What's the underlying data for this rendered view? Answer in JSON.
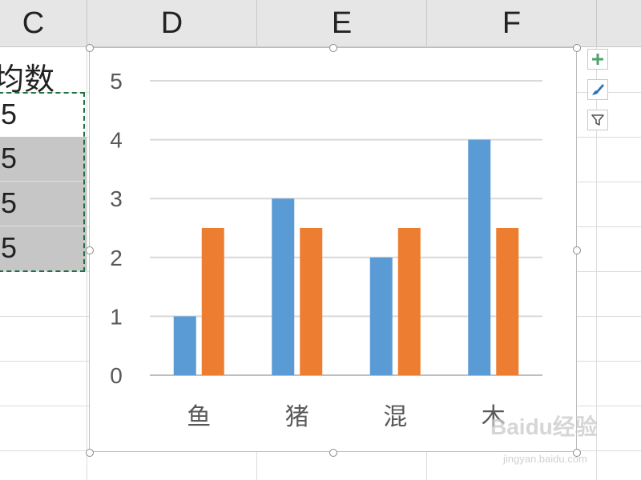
{
  "spreadsheet": {
    "columns": [
      "C",
      "D",
      "E",
      "F"
    ],
    "c_column": {
      "header_text": "均数",
      "values": [
        ".5",
        ".5",
        ".5",
        ".5"
      ]
    }
  },
  "chart_tools": {
    "icons": [
      "plus-icon",
      "brush-icon",
      "filter-icon"
    ]
  },
  "watermark": {
    "text": "Baidu经验",
    "sub": "jingyan.baidu.com"
  },
  "chart_data": {
    "type": "bar",
    "categories": [
      "鱼",
      "猪",
      "混",
      "木"
    ],
    "series": [
      {
        "values": [
          1,
          3,
          2,
          4
        ],
        "color": "#5b9bd5"
      },
      {
        "values": [
          2.5,
          2.5,
          2.5,
          2.5
        ],
        "color": "#ed7d31"
      }
    ],
    "ylim": [
      0,
      5
    ],
    "yticks": [
      "0",
      "1",
      "2",
      "3",
      "4",
      "5"
    ],
    "grid": true,
    "title": "",
    "xlabel": "",
    "ylabel": ""
  }
}
